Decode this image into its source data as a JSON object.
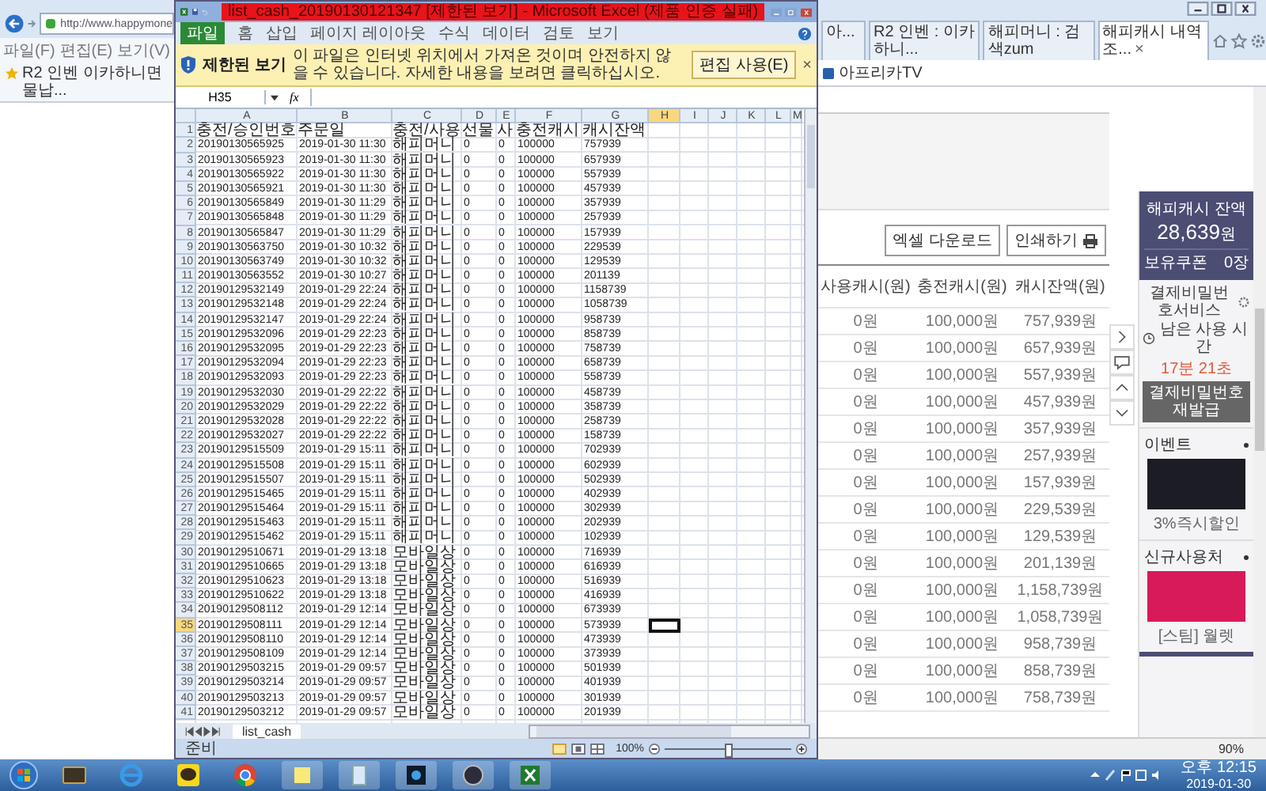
{
  "browser": {
    "address": "http://www.happymone",
    "menu": [
      "파일(F)",
      "편집(E)",
      "보기(V)"
    ],
    "favorite_left": "R2 인벤 이카하니면물납...",
    "tabs": [
      {
        "label": "아...",
        "selected": false
      },
      {
        "label": "R2 인벤 : 이카하니...",
        "selected": false
      },
      {
        "label": "해피머니 : 검색zum",
        "selected": false
      },
      {
        "label": "해피캐시 내역 조...",
        "selected": true,
        "close": "×"
      }
    ],
    "favorite_right": "아프리카TV",
    "buttons": [
      {
        "label": "엑셀 다운로드",
        "kind": "plain"
      },
      {
        "label": "인쇄하기",
        "kind": "print"
      }
    ],
    "table": {
      "columns": [
        "사용캐시(원)",
        "충전캐시(원)",
        "캐시잔액(원)"
      ],
      "rows": [
        [
          "0원",
          "100,000원",
          "757,939원"
        ],
        [
          "0원",
          "100,000원",
          "657,939원"
        ],
        [
          "0원",
          "100,000원",
          "557,939원"
        ],
        [
          "0원",
          "100,000원",
          "457,939원"
        ],
        [
          "0원",
          "100,000원",
          "357,939원"
        ],
        [
          "0원",
          "100,000원",
          "257,939원"
        ],
        [
          "0원",
          "100,000원",
          "157,939원"
        ],
        [
          "0원",
          "100,000원",
          "229,539원"
        ],
        [
          "0원",
          "100,000원",
          "129,539원"
        ],
        [
          "0원",
          "100,000원",
          "201,139원"
        ],
        [
          "0원",
          "100,000원",
          "1,158,739원"
        ],
        [
          "0원",
          "100,000원",
          "1,058,739원"
        ],
        [
          "0원",
          "100,000원",
          "958,739원"
        ],
        [
          "0원",
          "100,000원",
          "858,739원"
        ],
        [
          "0원",
          "100,000원",
          "758,739원"
        ]
      ]
    },
    "sidebar": {
      "balance_title": "해피캐시 잔액",
      "balance": "28,639",
      "balance_unit": "원",
      "coupon_label": "보유쿠폰",
      "coupon_value": "0장",
      "service": "결제비밀번호서비스",
      "time_label": "남은 사용 시간",
      "time_value": "17분 21초",
      "reissue_button": "결제비밀번호 재발급",
      "sections": [
        {
          "title": "이벤트",
          "caption": "3%즉시할인",
          "color": "#1c1c24"
        },
        {
          "title": "신규사용처",
          "caption": "[스팀] 월렛",
          "color": "#d8195a"
        }
      ]
    },
    "zoom": "90%"
  },
  "excel": {
    "title": "list_cash_20190130121347 [제한된 보기] - Microsoft Excel (제품 인증 실패)",
    "ribbon_tabs": [
      {
        "label": "파일",
        "kind": "file"
      },
      {
        "label": "홈",
        "kind": "tab"
      },
      {
        "label": "삽입",
        "kind": "tab"
      },
      {
        "label": "페이지 레이아웃",
        "kind": "tab"
      },
      {
        "label": "수식",
        "kind": "tab"
      },
      {
        "label": "데이터",
        "kind": "tab"
      },
      {
        "label": "검토",
        "kind": "tab"
      },
      {
        "label": "보기",
        "kind": "tab"
      }
    ],
    "message_bar": {
      "title": "제한된 보기",
      "text": "이 파일은 인터넷 위치에서 가져온 것이며 안전하지 않을 수 있습니다. 자세한 내용을 보려면 클릭하십시오.",
      "button": "편집 사용(E)",
      "close": "×"
    },
    "name_box": "H35",
    "function_label": "fx",
    "columns": [
      {
        "letter": "A",
        "selected": false
      },
      {
        "letter": "B",
        "selected": false
      },
      {
        "letter": "C",
        "selected": false
      },
      {
        "letter": "D",
        "selected": false
      },
      {
        "letter": "E",
        "selected": false
      },
      {
        "letter": "F",
        "selected": false
      },
      {
        "letter": "G",
        "selected": false
      },
      {
        "letter": "H",
        "selected": true
      },
      {
        "letter": "I",
        "selected": false
      },
      {
        "letter": "J",
        "selected": false
      },
      {
        "letter": "K",
        "selected": false
      },
      {
        "letter": "L",
        "selected": false
      },
      {
        "letter": "M",
        "selected": false
      }
    ],
    "rows": [
      {
        "number": "1",
        "selected": false,
        "cells": [
          "충전/승인번호",
          "주문일",
          "충전/사용",
          "선물",
          "사",
          "충전캐시",
          "캐시잔액"
        ]
      },
      {
        "number": "2",
        "selected": false,
        "cells": [
          "20190130565925",
          "2019-01-30 11:30",
          "해피머니",
          "0",
          "0",
          "100000",
          "757939"
        ]
      },
      {
        "number": "3",
        "selected": false,
        "cells": [
          "20190130565923",
          "2019-01-30 11:30",
          "해피머니",
          "0",
          "0",
          "100000",
          "657939"
        ]
      },
      {
        "number": "4",
        "selected": false,
        "cells": [
          "20190130565922",
          "2019-01-30 11:30",
          "해피머니",
          "0",
          "0",
          "100000",
          "557939"
        ]
      },
      {
        "number": "5",
        "selected": false,
        "cells": [
          "20190130565921",
          "2019-01-30 11:30",
          "해피머니",
          "0",
          "0",
          "100000",
          "457939"
        ]
      },
      {
        "number": "6",
        "selected": false,
        "cells": [
          "20190130565849",
          "2019-01-30 11:29",
          "해피머니",
          "0",
          "0",
          "100000",
          "357939"
        ]
      },
      {
        "number": "7",
        "selected": false,
        "cells": [
          "20190130565848",
          "2019-01-30 11:29",
          "해피머니",
          "0",
          "0",
          "100000",
          "257939"
        ]
      },
      {
        "number": "8",
        "selected": false,
        "cells": [
          "20190130565847",
          "2019-01-30 11:29",
          "해피머니",
          "0",
          "0",
          "100000",
          "157939"
        ]
      },
      {
        "number": "9",
        "selected": false,
        "cells": [
          "20190130563750",
          "2019-01-30 10:32",
          "해피머니",
          "0",
          "0",
          "100000",
          "229539"
        ]
      },
      {
        "number": "10",
        "selected": false,
        "cells": [
          "20190130563749",
          "2019-01-30 10:32",
          "해피머니",
          "0",
          "0",
          "100000",
          "129539"
        ]
      },
      {
        "number": "11",
        "selected": false,
        "cells": [
          "20190130563552",
          "2019-01-30 10:27",
          "해피머니",
          "0",
          "0",
          "100000",
          "201139"
        ]
      },
      {
        "number": "12",
        "selected": false,
        "cells": [
          "20190129532149",
          "2019-01-29 22:24",
          "해피머니",
          "0",
          "0",
          "100000",
          "1158739"
        ]
      },
      {
        "number": "13",
        "selected": false,
        "cells": [
          "20190129532148",
          "2019-01-29 22:24",
          "해피머니",
          "0",
          "0",
          "100000",
          "1058739"
        ]
      },
      {
        "number": "14",
        "selected": false,
        "cells": [
          "20190129532147",
          "2019-01-29 22:24",
          "해피머니",
          "0",
          "0",
          "100000",
          "958739"
        ]
      },
      {
        "number": "15",
        "selected": false,
        "cells": [
          "20190129532096",
          "2019-01-29 22:23",
          "해피머니",
          "0",
          "0",
          "100000",
          "858739"
        ]
      },
      {
        "number": "16",
        "selected": false,
        "cells": [
          "20190129532095",
          "2019-01-29 22:23",
          "해피머니",
          "0",
          "0",
          "100000",
          "758739"
        ]
      },
      {
        "number": "17",
        "selected": false,
        "cells": [
          "20190129532094",
          "2019-01-29 22:23",
          "해피머니",
          "0",
          "0",
          "100000",
          "658739"
        ]
      },
      {
        "number": "18",
        "selected": false,
        "cells": [
          "20190129532093",
          "2019-01-29 22:23",
          "해피머니",
          "0",
          "0",
          "100000",
          "558739"
        ]
      },
      {
        "number": "19",
        "selected": false,
        "cells": [
          "20190129532030",
          "2019-01-29 22:22",
          "해피머니",
          "0",
          "0",
          "100000",
          "458739"
        ]
      },
      {
        "number": "20",
        "selected": false,
        "cells": [
          "20190129532029",
          "2019-01-29 22:22",
          "해피머니",
          "0",
          "0",
          "100000",
          "358739"
        ]
      },
      {
        "number": "21",
        "selected": false,
        "cells": [
          "20190129532028",
          "2019-01-29 22:22",
          "해피머니",
          "0",
          "0",
          "100000",
          "258739"
        ]
      },
      {
        "number": "22",
        "selected": false,
        "cells": [
          "20190129532027",
          "2019-01-29 22:22",
          "해피머니",
          "0",
          "0",
          "100000",
          "158739"
        ]
      },
      {
        "number": "23",
        "selected": false,
        "cells": [
          "20190129515509",
          "2019-01-29 15:11",
          "해피머니",
          "0",
          "0",
          "100000",
          "702939"
        ]
      },
      {
        "number": "24",
        "selected": false,
        "cells": [
          "20190129515508",
          "2019-01-29 15:11",
          "해피머니",
          "0",
          "0",
          "100000",
          "602939"
        ]
      },
      {
        "number": "25",
        "selected": false,
        "cells": [
          "20190129515507",
          "2019-01-29 15:11",
          "해피머니",
          "0",
          "0",
          "100000",
          "502939"
        ]
      },
      {
        "number": "26",
        "selected": false,
        "cells": [
          "20190129515465",
          "2019-01-29 15:11",
          "해피머니",
          "0",
          "0",
          "100000",
          "402939"
        ]
      },
      {
        "number": "27",
        "selected": false,
        "cells": [
          "20190129515464",
          "2019-01-29 15:11",
          "해피머니",
          "0",
          "0",
          "100000",
          "302939"
        ]
      },
      {
        "number": "28",
        "selected": false,
        "cells": [
          "20190129515463",
          "2019-01-29 15:11",
          "해피머니",
          "0",
          "0",
          "100000",
          "202939"
        ]
      },
      {
        "number": "29",
        "selected": false,
        "cells": [
          "20190129515462",
          "2019-01-29 15:11",
          "해피머니",
          "0",
          "0",
          "100000",
          "102939"
        ]
      },
      {
        "number": "30",
        "selected": false,
        "cells": [
          "20190129510671",
          "2019-01-29 13:18",
          "모바일상",
          "0",
          "0",
          "100000",
          "716939"
        ]
      },
      {
        "number": "31",
        "selected": false,
        "cells": [
          "20190129510665",
          "2019-01-29 13:18",
          "모바일상",
          "0",
          "0",
          "100000",
          "616939"
        ]
      },
      {
        "number": "32",
        "selected": false,
        "cells": [
          "20190129510623",
          "2019-01-29 13:18",
          "모바일상",
          "0",
          "0",
          "100000",
          "516939"
        ]
      },
      {
        "number": "33",
        "selected": false,
        "cells": [
          "20190129510622",
          "2019-01-29 13:18",
          "모바일상",
          "0",
          "0",
          "100000",
          "416939"
        ]
      },
      {
        "number": "34",
        "selected": false,
        "cells": [
          "20190129508112",
          "2019-01-29 12:14",
          "모바일상",
          "0",
          "0",
          "100000",
          "673939"
        ]
      },
      {
        "number": "35",
        "selected": true,
        "cells": [
          "20190129508111",
          "2019-01-29 12:14",
          "모바일상",
          "0",
          "0",
          "100000",
          "573939"
        ]
      },
      {
        "number": "36",
        "selected": false,
        "cells": [
          "20190129508110",
          "2019-01-29 12:14",
          "모바일상",
          "0",
          "0",
          "100000",
          "473939"
        ]
      },
      {
        "number": "37",
        "selected": false,
        "cells": [
          "20190129508109",
          "2019-01-29 12:14",
          "모바일상",
          "0",
          "0",
          "100000",
          "373939"
        ]
      },
      {
        "number": "38",
        "selected": false,
        "cells": [
          "20190129503215",
          "2019-01-29 09:57",
          "모바일상",
          "0",
          "0",
          "100000",
          "501939"
        ]
      },
      {
        "number": "39",
        "selected": false,
        "cells": [
          "20190129503214",
          "2019-01-29 09:57",
          "모바일상",
          "0",
          "0",
          "100000",
          "401939"
        ]
      },
      {
        "number": "40",
        "selected": false,
        "cells": [
          "20190129503213",
          "2019-01-29 09:57",
          "모바일상",
          "0",
          "0",
          "100000",
          "301939"
        ]
      },
      {
        "number": "41",
        "selected": false,
        "cells": [
          "20190129503212",
          "2019-01-29 09:57",
          "모바일상",
          "0",
          "0",
          "100000",
          "201939"
        ]
      }
    ],
    "sheet_tabs": [
      {
        "label": "list_cash",
        "selected": true
      }
    ],
    "status": "준비",
    "zoom": "100%",
    "zoom_slider": {
      "level": 0.5
    }
  },
  "taskbar": {
    "time": "오후 12:15",
    "date": "2019-01-30"
  }
}
